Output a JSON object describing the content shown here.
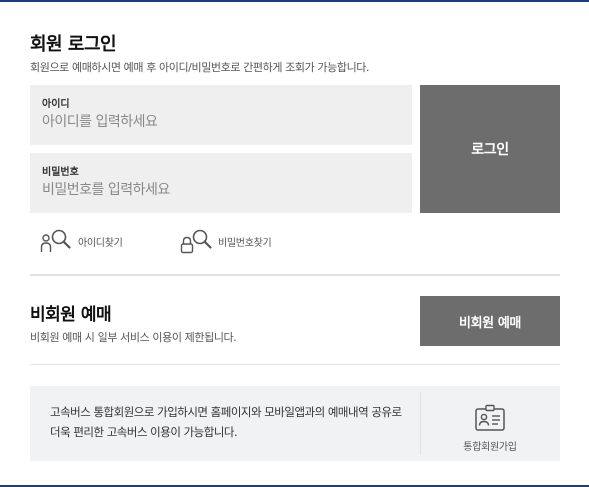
{
  "member_login": {
    "title": "회원 로그인",
    "description": "회원으로 예매하시면 예매 후 아이디/비밀번호로 간편하게 조회가 가능합니다.",
    "id_field": {
      "label": "아이디",
      "placeholder": "아이디를 입력하세요",
      "value": ""
    },
    "password_field": {
      "label": "비밀번호",
      "placeholder": "비밀번호를 입력하세요",
      "value": ""
    },
    "login_button": "로그인",
    "find_id": {
      "label": "아이디찾기",
      "icon": "find-user-icon"
    },
    "find_password": {
      "label": "비밀번호찾기",
      "icon": "find-lock-icon"
    }
  },
  "guest_booking": {
    "title": "비회원 예매",
    "description": "비회원 예매 시 일부 서비스 이용이 제한됩니다.",
    "button": "비회원 예매"
  },
  "promo": {
    "text": "고속버스 통합회원으로 가입하시면 홈페이지와 모바일앱과의 예매내역 공유로더욱 편리한 고속버스 이용이 가능합니다.",
    "join_label": "통합회원가입",
    "join_icon": "member-card-icon"
  },
  "colors": {
    "accent_line": "#1f3f7a",
    "button_bg": "#6d6d6d",
    "field_bg": "#efefef",
    "promo_bg": "#f1f2f4"
  }
}
